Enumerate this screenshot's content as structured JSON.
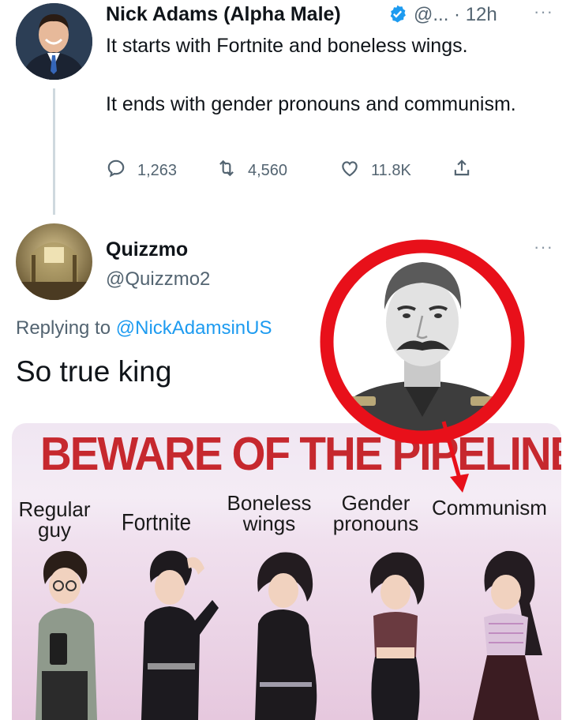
{
  "tweet1": {
    "author_name": "Nick Adams (Alpha Male)",
    "handle_time": "@... · 12h",
    "paragraphs": [
      "It starts with Fortnite and boneless wings.",
      "It ends with gender pronouns and communism."
    ],
    "stats": {
      "replies": "1,263",
      "retweets": "4,560",
      "likes": "11.8K"
    },
    "more": "···"
  },
  "tweet2": {
    "author_name": "Quizzmo",
    "handle": "@Quizzmo2",
    "replying_prefix": "Replying to ",
    "replying_handle": "@NickAdamsinUS",
    "body": "So true king",
    "more": "···"
  },
  "meme": {
    "title": "BEWARE OF THE PIPELINE",
    "stages": [
      "Regular guy",
      "Fortnite",
      "Boneless wings",
      "Gender pronouns",
      "Communism"
    ]
  },
  "colors": {
    "accent_link": "#1d9bf0",
    "verified": "#1d9bf0",
    "meme_title": "#c6282e",
    "annotation_red": "#e8101a"
  },
  "icons": [
    "verified-icon",
    "reply-icon",
    "retweet-icon",
    "like-icon",
    "share-icon",
    "more-icon"
  ]
}
